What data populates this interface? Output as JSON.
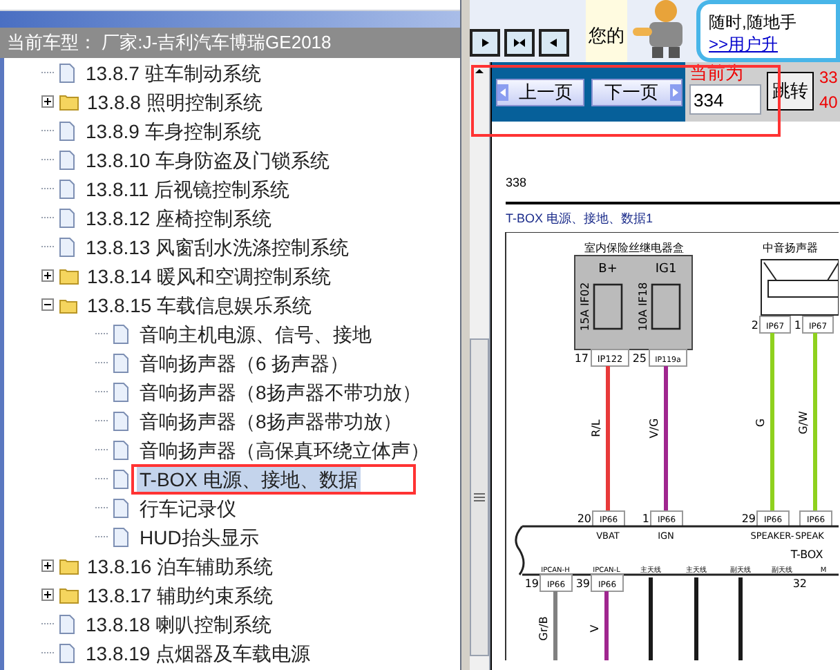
{
  "header": {
    "vehicle": "当前车型： 厂家:J-吉利汽车博瑞GE2018"
  },
  "top_bar": {
    "greeting": "您的",
    "promo_lines": [
      "随时,随地手"
    ],
    "promo_link": ">>用户升",
    "side_numbers": [
      "33",
      "40"
    ]
  },
  "tree": {
    "items": [
      {
        "kind": "page",
        "label": "13.8.7 驻车制动系统",
        "selected": false
      },
      {
        "kind": "folder",
        "label": "13.8.8 照明控制系统",
        "expanded": false,
        "selected": false
      },
      {
        "kind": "page",
        "label": "13.8.9 车身控制系统",
        "selected": false
      },
      {
        "kind": "page",
        "label": "13.8.10 车身防盗及门锁系统",
        "selected": false
      },
      {
        "kind": "page",
        "label": "13.8.11 后视镜控制系统",
        "selected": false
      },
      {
        "kind": "page",
        "label": "13.8.12 座椅控制系统",
        "selected": false
      },
      {
        "kind": "page",
        "label": "13.8.13 风窗刮水洗涤控制系统",
        "selected": false
      },
      {
        "kind": "folder",
        "label": "13.8.14 暖风和空调控制系统",
        "expanded": false,
        "selected": false
      },
      {
        "kind": "folder",
        "label": "13.8.15 车载信息娱乐系统",
        "expanded": true,
        "selected": false,
        "children": [
          {
            "kind": "page",
            "label": "音响主机电源、信号、接地",
            "selected": false
          },
          {
            "kind": "page",
            "label": "音响扬声器（6 扬声器）",
            "selected": false
          },
          {
            "kind": "page",
            "label": "音响扬声器（8扬声器不带功放）",
            "selected": false
          },
          {
            "kind": "page",
            "label": "音响扬声器（8扬声器带功放）",
            "selected": false
          },
          {
            "kind": "page",
            "label": "音响扬声器（高保真环绕立体声）",
            "selected": false
          },
          {
            "kind": "page",
            "label": "T-BOX 电源、接地、数据",
            "selected": true
          },
          {
            "kind": "page",
            "label": "行车记录仪",
            "selected": false
          },
          {
            "kind": "page",
            "label": "HUD抬头显示",
            "selected": false
          }
        ]
      },
      {
        "kind": "folder",
        "label": "13.8.16 泊车辅助系统",
        "expanded": false,
        "selected": false
      },
      {
        "kind": "folder",
        "label": "13.8.17 辅助约束系统",
        "expanded": false,
        "selected": false
      },
      {
        "kind": "page",
        "label": "13.8.18 喇叭控制系统",
        "selected": false
      },
      {
        "kind": "page",
        "label": "13.8.19 点烟器及车载电源",
        "selected": false
      }
    ]
  },
  "pager": {
    "prev": "上一页",
    "next": "下一页",
    "current_label": "当前为",
    "page_value": "334",
    "jump": "跳转"
  },
  "document": {
    "page_number": "338",
    "title": "T-BOX 电源、接地、数据1",
    "fuse_box": {
      "title": "室内保险丝继电器盒",
      "supplies": [
        {
          "label": "B+",
          "fuse": "15A IF02",
          "pin": "17",
          "connector": "IP122",
          "wire": "R/L",
          "color": "#e83a3a"
        },
        {
          "label": "IG1",
          "fuse": "10A IF18",
          "pin": "25",
          "connector": "IP119a",
          "wire": "V/G",
          "color": "#a0268f"
        }
      ]
    },
    "speaker": {
      "title": "中音扬声器",
      "pins": [
        {
          "pin": "2",
          "connector": "IP67",
          "wire": "G",
          "color": "#8fd11e"
        },
        {
          "pin": "1",
          "connector": "IP67",
          "wire": "G/W",
          "color": "#8fd11e"
        }
      ]
    },
    "tbox": {
      "name": "T-BOX",
      "top_pins": [
        {
          "pin": "20",
          "connector": "IP66",
          "signal": "VBAT"
        },
        {
          "pin": "1",
          "connector": "IP66",
          "signal": "IGN"
        },
        {
          "pin": "29",
          "connector": "IP66",
          "signal": "SPEAKER-"
        },
        {
          "connector": "IP66",
          "signal": "SPEAK"
        }
      ],
      "bottom_pins": [
        {
          "signal": "IPCAN-H",
          "pin": "19",
          "connector": "IP66",
          "wire": "Gr/B",
          "color": "#808080"
        },
        {
          "signal": "IPCAN-L",
          "pin": "39",
          "connector": "IP66",
          "wire": "V",
          "color": "#a0268f"
        },
        {
          "signal": "主天线",
          "color": "#1a1a1a"
        },
        {
          "signal": "主天线",
          "color": "#1a1a1a"
        },
        {
          "signal": "副天线",
          "color": "#1a1a1a"
        },
        {
          "signal": "副天线"
        },
        {
          "signal": "M",
          "pin": "32"
        }
      ]
    }
  }
}
